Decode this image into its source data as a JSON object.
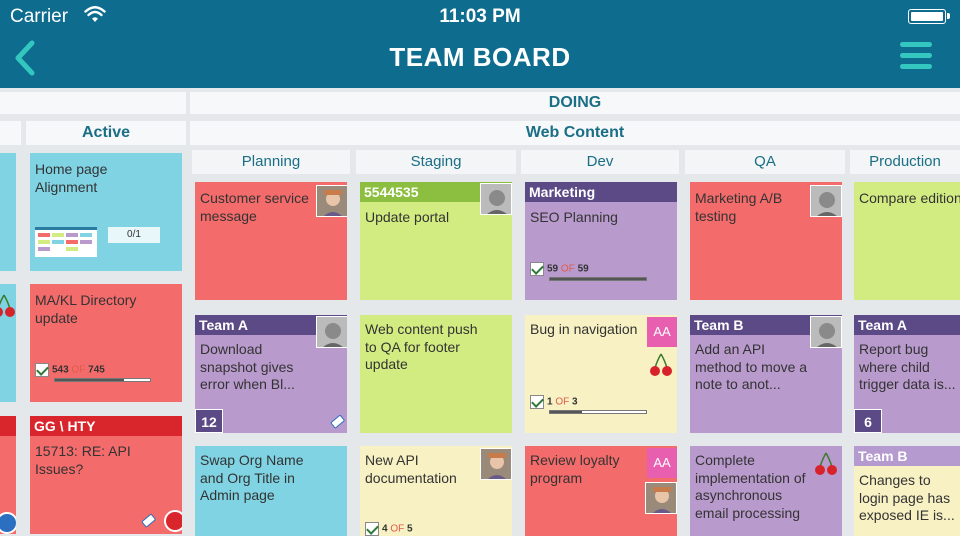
{
  "status_bar": {
    "carrier": "Carrier",
    "time": "11:03 PM"
  },
  "nav": {
    "title": "TEAM BOARD"
  },
  "board": {
    "section_header": "DOING",
    "active_header": "Active",
    "lane_group_header": "Web Content",
    "columns": [
      "Planning",
      "Staging",
      "Dev",
      "QA",
      "Production"
    ]
  },
  "cards": {
    "active_1": {
      "title": "Home page Alignment",
      "counter": "0/1"
    },
    "active_2": {
      "title": "MA/KL Directory update",
      "progress_done": "543",
      "progress_of": "OF",
      "progress_total": "745",
      "progress_fraction": 0.73
    },
    "active_3": {
      "banner": "GG \\ HTY",
      "title": "15713: RE: API Issues?"
    },
    "planning_1": {
      "title": "Customer service message"
    },
    "planning_2": {
      "banner": "Team A",
      "title": "Download snapshot gives error when Bl...",
      "badge": "12"
    },
    "planning_3": {
      "title": "Swap Org Name and Org Title in Admin page"
    },
    "staging_1": {
      "banner": "5544535",
      "title": "Update portal"
    },
    "staging_2": {
      "title": "Web content push to QA for footer update"
    },
    "staging_3": {
      "title": "New API documentation",
      "progress_done": "4",
      "progress_of": "OF",
      "progress_total": "5",
      "progress_fraction": 0.8
    },
    "dev_1": {
      "banner": "Marketing",
      "title": "SEO Planning",
      "progress_done": "59",
      "progress_of": "OF",
      "progress_total": "59",
      "progress_fraction": 1.0
    },
    "dev_2": {
      "title": "Bug in navigation",
      "avatar_initials": "AA",
      "progress_done": "1",
      "progress_of": "OF",
      "progress_total": "3",
      "progress_fraction": 0.33
    },
    "dev_3": {
      "title": "Review loyalty program",
      "avatar_initials": "AA"
    },
    "qa_1": {
      "title": "Marketing A/B testing"
    },
    "qa_2": {
      "banner": "Team B",
      "title": "Add an API method to move a note to anot..."
    },
    "qa_3": {
      "title": "Complete implementation of asynchronous email processing"
    },
    "prod_1": {
      "title": "Compare editions update"
    },
    "prod_2": {
      "banner": "Team A",
      "title": "Report bug where child trigger data is...",
      "badge": "6"
    },
    "prod_3": {
      "banner": "Team B",
      "title": "Changes to login page has exposed IE is..."
    }
  },
  "colors": {
    "nav_bg": "#0e6d8e",
    "card_blue": "#7fd3e3",
    "card_red": "#f46b6b",
    "card_green": "#d3ec82",
    "card_purple": "#b99acd",
    "card_yellow": "#f7f1c3",
    "banner_purple": "#5b4a86",
    "banner_green": "#8cbf3f",
    "banner_red": "#d9262d",
    "banner_lavender": "#b59ad0"
  },
  "icons": [
    "wifi-icon",
    "battery-icon",
    "back-chevron-icon",
    "hamburger-menu-icon",
    "cherry-icon",
    "tag-icon",
    "checkbox-icon",
    "avatar-icon"
  ]
}
